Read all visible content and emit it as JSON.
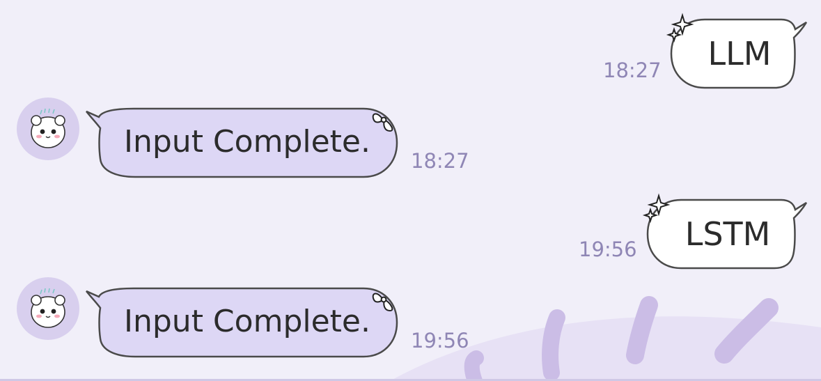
{
  "theme": {
    "background": "#f1eff9",
    "incoming_bubble": "#ddd7f5",
    "outgoing_bubble": "#ffffff",
    "bubble_outline": "#4a4a4a",
    "timestamp_color": "#8f86b5",
    "avatar_bg": "#d8cfee",
    "decoration_color": "#cbbde6"
  },
  "messages": [
    {
      "direction": "outgoing",
      "text": "LLM",
      "time": "18:27",
      "sticker_icon": "sparkle-icon"
    },
    {
      "direction": "incoming",
      "text": "Input Complete.",
      "time": "18:27",
      "sticker_icon": "ribbon-bow-icon",
      "avatar_icon": "hamster-avatar-icon"
    },
    {
      "direction": "outgoing",
      "text": "LSTM",
      "time": "19:56",
      "sticker_icon": "sparkle-icon"
    },
    {
      "direction": "incoming",
      "text": "Input Complete.",
      "time": "19:56",
      "sticker_icon": "ribbon-bow-icon",
      "avatar_icon": "hamster-avatar-icon"
    }
  ]
}
